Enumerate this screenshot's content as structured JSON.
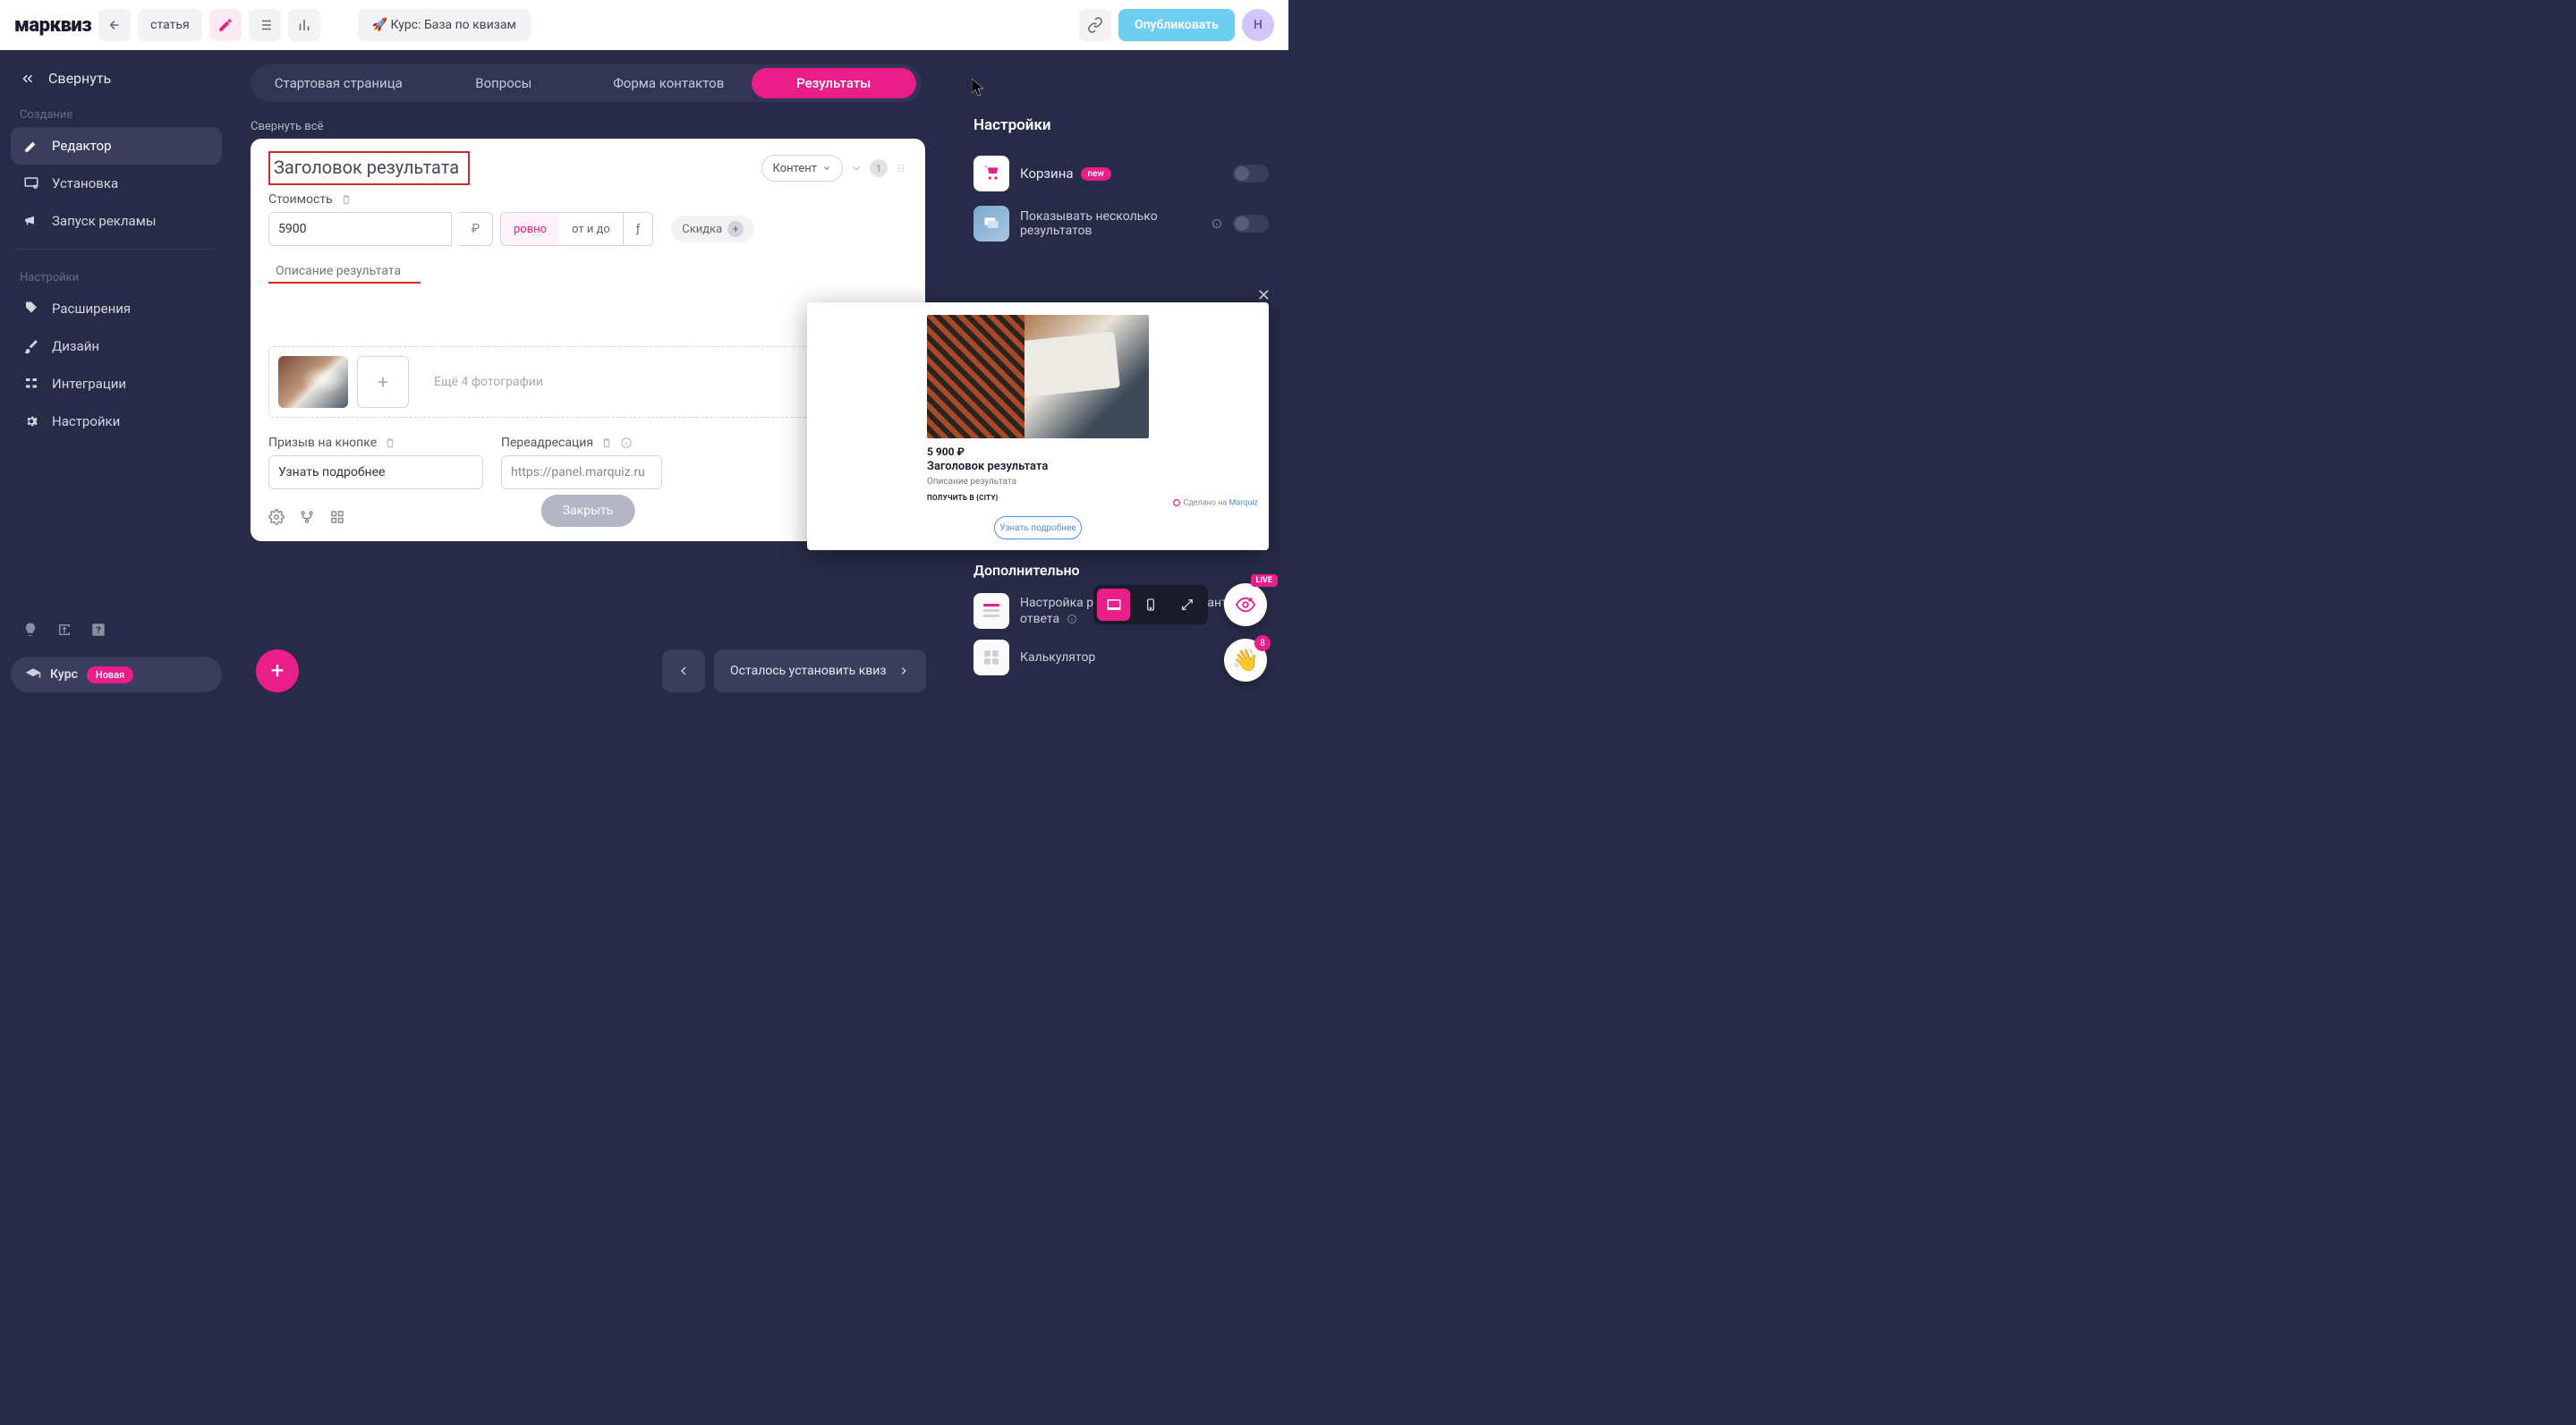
{
  "topbar": {
    "logo": "марквиз",
    "chip_article": "статья",
    "course": "🚀 Курс: База по квизам",
    "publish": "Опубликовать",
    "avatar": "Н"
  },
  "sidebar": {
    "collapse": "Свернуть",
    "section_create": "Создание",
    "editor": "Редактор",
    "install": "Установка",
    "ads": "Запуск рекламы",
    "section_settings": "Настройки",
    "extensions": "Расширения",
    "design": "Дизайн",
    "integrations": "Интеграции",
    "settings": "Настройки",
    "course_label": "Курс",
    "course_badge": "Новая"
  },
  "tabs": {
    "t1": "Стартовая страница",
    "t2": "Вопросы",
    "t3": "Форма контактов",
    "t4": "Результаты"
  },
  "collapse_all": "Свернуть всё",
  "card": {
    "title": "Заголовок результата",
    "content_dd": "Контент",
    "order": "1",
    "price_label": "Стоимость",
    "price_value": "5900",
    "currency": "₽",
    "seg_eq": "ровно",
    "seg_range": "от и до",
    "fx": "ƒ",
    "discount": "Скидка",
    "desc_placeholder": "Описание результата",
    "thumb_more": "Ещё 4 фотографии",
    "cta_label": "Призыв на кнопке",
    "cta_value": "Узнать подробнее",
    "redirect_label": "Переадресация",
    "redirect_value": "https://panel.marquiz.ru",
    "close": "Закрыть"
  },
  "right": {
    "title": "Настройки",
    "cart": "Корзина",
    "cart_badge": "new",
    "multi": "Показывать несколько результатов"
  },
  "preview": {
    "price": "5 900 ₽",
    "title": "Заголовок результата",
    "desc": "Описание результата",
    "cta_small": "ПОЛУЧИТЬ В {CITY}",
    "brand_prefix": "Сделано на ",
    "brand_link": "Marquiz",
    "btn": "Узнать подробнее"
  },
  "additional": {
    "title": "Дополнительно",
    "r1": "Настройка результатов по вариантам ответа",
    "r2": "Калькулятор"
  },
  "fab": {
    "live": "LIVE",
    "wave_count": "8"
  },
  "bottom": {
    "remaining": "Осталось установить квиз"
  }
}
